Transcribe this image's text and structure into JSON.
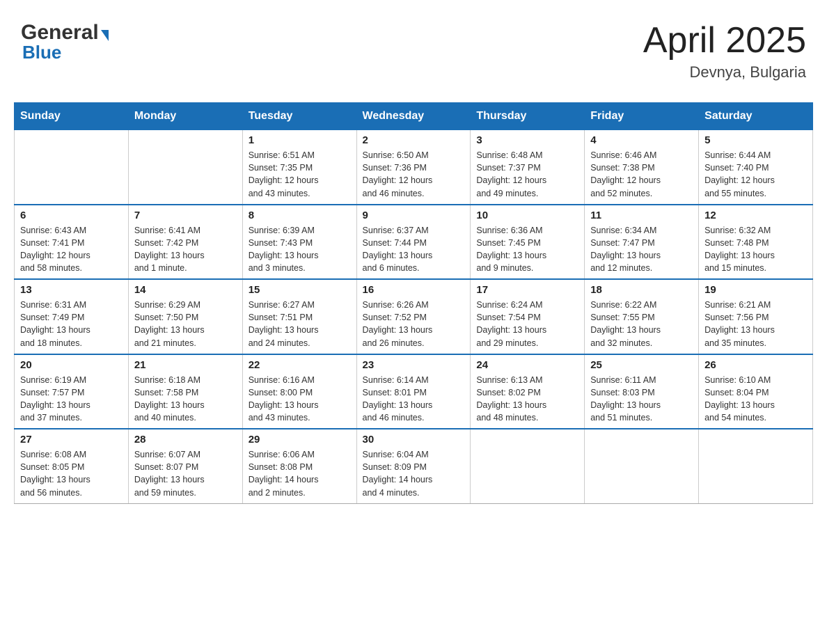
{
  "header": {
    "logo": {
      "general": "General",
      "triangle": "▼",
      "blue": "Blue"
    },
    "title": "April 2025",
    "location": "Devnya, Bulgaria"
  },
  "days_of_week": [
    "Sunday",
    "Monday",
    "Tuesday",
    "Wednesday",
    "Thursday",
    "Friday",
    "Saturday"
  ],
  "weeks": [
    [
      {
        "day": "",
        "info": ""
      },
      {
        "day": "",
        "info": ""
      },
      {
        "day": "1",
        "info": "Sunrise: 6:51 AM\nSunset: 7:35 PM\nDaylight: 12 hours\nand 43 minutes."
      },
      {
        "day": "2",
        "info": "Sunrise: 6:50 AM\nSunset: 7:36 PM\nDaylight: 12 hours\nand 46 minutes."
      },
      {
        "day": "3",
        "info": "Sunrise: 6:48 AM\nSunset: 7:37 PM\nDaylight: 12 hours\nand 49 minutes."
      },
      {
        "day": "4",
        "info": "Sunrise: 6:46 AM\nSunset: 7:38 PM\nDaylight: 12 hours\nand 52 minutes."
      },
      {
        "day": "5",
        "info": "Sunrise: 6:44 AM\nSunset: 7:40 PM\nDaylight: 12 hours\nand 55 minutes."
      }
    ],
    [
      {
        "day": "6",
        "info": "Sunrise: 6:43 AM\nSunset: 7:41 PM\nDaylight: 12 hours\nand 58 minutes."
      },
      {
        "day": "7",
        "info": "Sunrise: 6:41 AM\nSunset: 7:42 PM\nDaylight: 13 hours\nand 1 minute."
      },
      {
        "day": "8",
        "info": "Sunrise: 6:39 AM\nSunset: 7:43 PM\nDaylight: 13 hours\nand 3 minutes."
      },
      {
        "day": "9",
        "info": "Sunrise: 6:37 AM\nSunset: 7:44 PM\nDaylight: 13 hours\nand 6 minutes."
      },
      {
        "day": "10",
        "info": "Sunrise: 6:36 AM\nSunset: 7:45 PM\nDaylight: 13 hours\nand 9 minutes."
      },
      {
        "day": "11",
        "info": "Sunrise: 6:34 AM\nSunset: 7:47 PM\nDaylight: 13 hours\nand 12 minutes."
      },
      {
        "day": "12",
        "info": "Sunrise: 6:32 AM\nSunset: 7:48 PM\nDaylight: 13 hours\nand 15 minutes."
      }
    ],
    [
      {
        "day": "13",
        "info": "Sunrise: 6:31 AM\nSunset: 7:49 PM\nDaylight: 13 hours\nand 18 minutes."
      },
      {
        "day": "14",
        "info": "Sunrise: 6:29 AM\nSunset: 7:50 PM\nDaylight: 13 hours\nand 21 minutes."
      },
      {
        "day": "15",
        "info": "Sunrise: 6:27 AM\nSunset: 7:51 PM\nDaylight: 13 hours\nand 24 minutes."
      },
      {
        "day": "16",
        "info": "Sunrise: 6:26 AM\nSunset: 7:52 PM\nDaylight: 13 hours\nand 26 minutes."
      },
      {
        "day": "17",
        "info": "Sunrise: 6:24 AM\nSunset: 7:54 PM\nDaylight: 13 hours\nand 29 minutes."
      },
      {
        "day": "18",
        "info": "Sunrise: 6:22 AM\nSunset: 7:55 PM\nDaylight: 13 hours\nand 32 minutes."
      },
      {
        "day": "19",
        "info": "Sunrise: 6:21 AM\nSunset: 7:56 PM\nDaylight: 13 hours\nand 35 minutes."
      }
    ],
    [
      {
        "day": "20",
        "info": "Sunrise: 6:19 AM\nSunset: 7:57 PM\nDaylight: 13 hours\nand 37 minutes."
      },
      {
        "day": "21",
        "info": "Sunrise: 6:18 AM\nSunset: 7:58 PM\nDaylight: 13 hours\nand 40 minutes."
      },
      {
        "day": "22",
        "info": "Sunrise: 6:16 AM\nSunset: 8:00 PM\nDaylight: 13 hours\nand 43 minutes."
      },
      {
        "day": "23",
        "info": "Sunrise: 6:14 AM\nSunset: 8:01 PM\nDaylight: 13 hours\nand 46 minutes."
      },
      {
        "day": "24",
        "info": "Sunrise: 6:13 AM\nSunset: 8:02 PM\nDaylight: 13 hours\nand 48 minutes."
      },
      {
        "day": "25",
        "info": "Sunrise: 6:11 AM\nSunset: 8:03 PM\nDaylight: 13 hours\nand 51 minutes."
      },
      {
        "day": "26",
        "info": "Sunrise: 6:10 AM\nSunset: 8:04 PM\nDaylight: 13 hours\nand 54 minutes."
      }
    ],
    [
      {
        "day": "27",
        "info": "Sunrise: 6:08 AM\nSunset: 8:05 PM\nDaylight: 13 hours\nand 56 minutes."
      },
      {
        "day": "28",
        "info": "Sunrise: 6:07 AM\nSunset: 8:07 PM\nDaylight: 13 hours\nand 59 minutes."
      },
      {
        "day": "29",
        "info": "Sunrise: 6:06 AM\nSunset: 8:08 PM\nDaylight: 14 hours\nand 2 minutes."
      },
      {
        "day": "30",
        "info": "Sunrise: 6:04 AM\nSunset: 8:09 PM\nDaylight: 14 hours\nand 4 minutes."
      },
      {
        "day": "",
        "info": ""
      },
      {
        "day": "",
        "info": ""
      },
      {
        "day": "",
        "info": ""
      }
    ]
  ]
}
